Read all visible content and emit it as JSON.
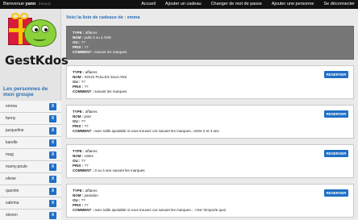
{
  "topbar": {
    "welcome_prefix": "Bienvenue",
    "user": "yann",
    "logout_hint": "(retour)",
    "menu": [
      "Accueil",
      "Ajouter un cadeau",
      "Changer de mot de passe",
      "Ajouter une personne",
      "Se déconnecter"
    ]
  },
  "sidebar": {
    "brand": "GestKdos",
    "title": "Les personnes de mon groupe",
    "remove_label": "X",
    "people": [
      "emma",
      "fanny",
      "jacqueline",
      "karelle",
      "mag",
      "mamy.poule",
      "olivier",
      "quentin",
      "sabrina",
      "steven"
    ]
  },
  "main": {
    "title": "Voici la liste de cadeaux de : emma",
    "reserve_label": "RESERVER",
    "labels": {
      "type": "TYPE :",
      "nom": "NOM :",
      "ou": "OU :",
      "prix": "PRIX :",
      "commentaire": "COMMENT :"
    },
    "gifts": [
      {
        "type": "affaires",
        "nom": "pulls 3 ou 4 ANS",
        "ou": "??",
        "prix": "??",
        "commentaire": "suivant les marques",
        "reserved": true
      },
      {
        "type": "affaires",
        "nom": "SOUS PULLES 3ou4 ANS",
        "ou": "??",
        "prix": "??",
        "commentaire": "suivant les marques",
        "reserved": false
      },
      {
        "type": "affaires",
        "nom": "jean",
        "ou": "??",
        "prix": "??",
        "commentaire": "avec taille ajustable si vous trouvez car suivant les marques...entre 2 et 3 ans",
        "reserved": false
      },
      {
        "type": "affaires",
        "nom": "robes",
        "ou": "??",
        "prix": "??",
        "commentaire": "3 ou 4 ans suivant les marques",
        "reserved": false
      },
      {
        "type": "affaires",
        "nom": "pantalon",
        "ou": "??",
        "prix": "??",
        "commentaire": "avec taille ajustable si vous trouvez car suivant les marques... c'est 'inmporte quoi",
        "reserved": false
      }
    ]
  }
}
